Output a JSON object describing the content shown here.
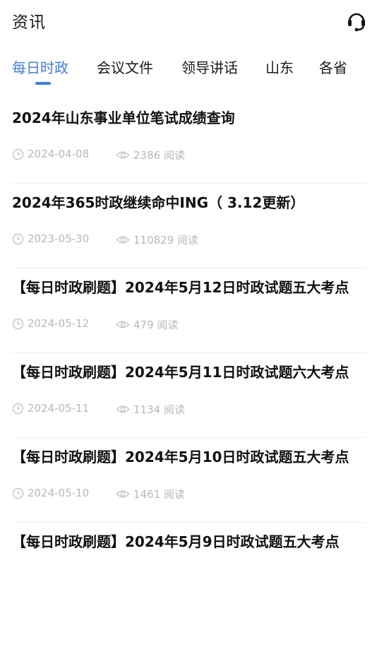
{
  "header": {
    "title": "资讯",
    "support_icon": "headset-icon"
  },
  "tabs": [
    {
      "label": "每日时政",
      "active": true
    },
    {
      "label": "会议文件",
      "active": false
    },
    {
      "label": "领导讲话",
      "active": false
    },
    {
      "label": "山东",
      "active": false
    },
    {
      "label": "各省",
      "active": false
    }
  ],
  "colors": {
    "accent": "#3f7fd6",
    "meta": "#b8b8b8"
  },
  "articles": [
    {
      "title": "2024年山东事业单位笔试成绩查询",
      "date": "2024-04-08",
      "views": "2386 阅读"
    },
    {
      "title": "2024年365时政继续命中ING（ 3.12更新）",
      "date": "2023-05-30",
      "views": "110829 阅读"
    },
    {
      "title": "【每日时政刷题】2024年5月12日时政试题五大考点",
      "date": "2024-05-12",
      "views": "479 阅读"
    },
    {
      "title": "【每日时政刷题】2024年5月11日时政试题六大考点",
      "date": "2024-05-11",
      "views": "1134 阅读"
    },
    {
      "title": "【每日时政刷题】2024年5月10日时政试题五大考点",
      "date": "2024-05-10",
      "views": "1461 阅读"
    },
    {
      "title": "【每日时政刷题】2024年5月9日时政试题五大考点",
      "date": "",
      "views": ""
    }
  ]
}
